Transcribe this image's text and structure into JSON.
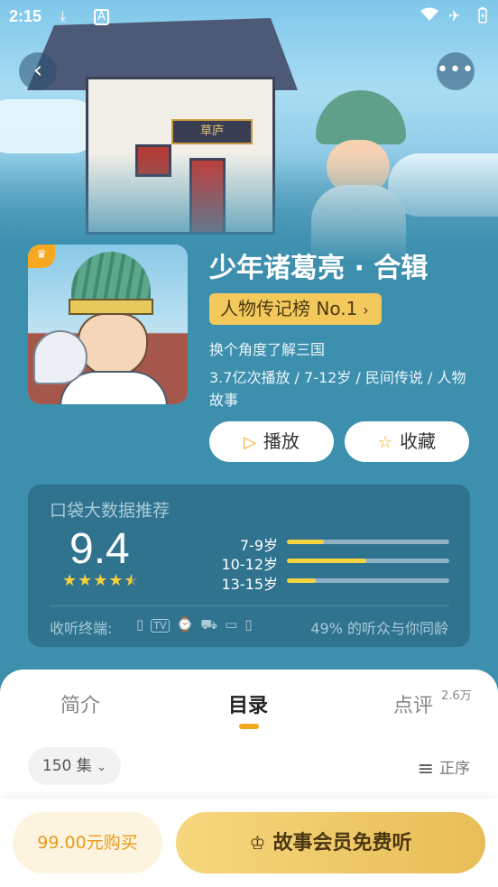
{
  "status_bar": {
    "time": "2:15",
    "icons": [
      "download-icon",
      "font-icon",
      "wifi-icon",
      "airplane-icon",
      "battery-icon"
    ]
  },
  "nav": {
    "back_icon": "chevron-left-icon",
    "more_icon": "more-dots-icon"
  },
  "hero": {
    "sign_text": "草庐"
  },
  "album": {
    "title": "少年诸葛亮 · 合辑",
    "rank_label": "人物传记榜 No.1",
    "subtitle": "换个角度了解三国",
    "meta": "3.7亿次播放 / 7-12岁 / 民间传说 / 人物故事"
  },
  "actions": {
    "play_label": "播放",
    "favorite_label": "收藏"
  },
  "stats": {
    "heading": "口袋大数据推荐",
    "score": "9.4",
    "stars": 4.5,
    "age_groups": [
      {
        "label": "7-9岁",
        "value": 0.23
      },
      {
        "label": "10-12岁",
        "value": 0.49
      },
      {
        "label": "13-15岁",
        "value": 0.18
      }
    ],
    "devices_label": "收听终端:",
    "device_icons": [
      "phone-icon",
      "tv-icon",
      "watch-icon",
      "car-icon",
      "tablet-icon",
      "speaker-icon"
    ],
    "same_age_text": "49% 的听众与你同龄"
  },
  "tabs": {
    "intro": "简介",
    "catalog": "目录",
    "review": "点评",
    "review_count": "2.6万"
  },
  "catalog": {
    "episodes_label": "150 集",
    "order_label": "正序"
  },
  "bottom": {
    "buy_label": "99.00元购买",
    "vip_label": "故事会员免费听"
  },
  "colors": {
    "accent": "#f2a81d",
    "background": "#3d8fae",
    "vip_gold": "#e8bd56"
  }
}
